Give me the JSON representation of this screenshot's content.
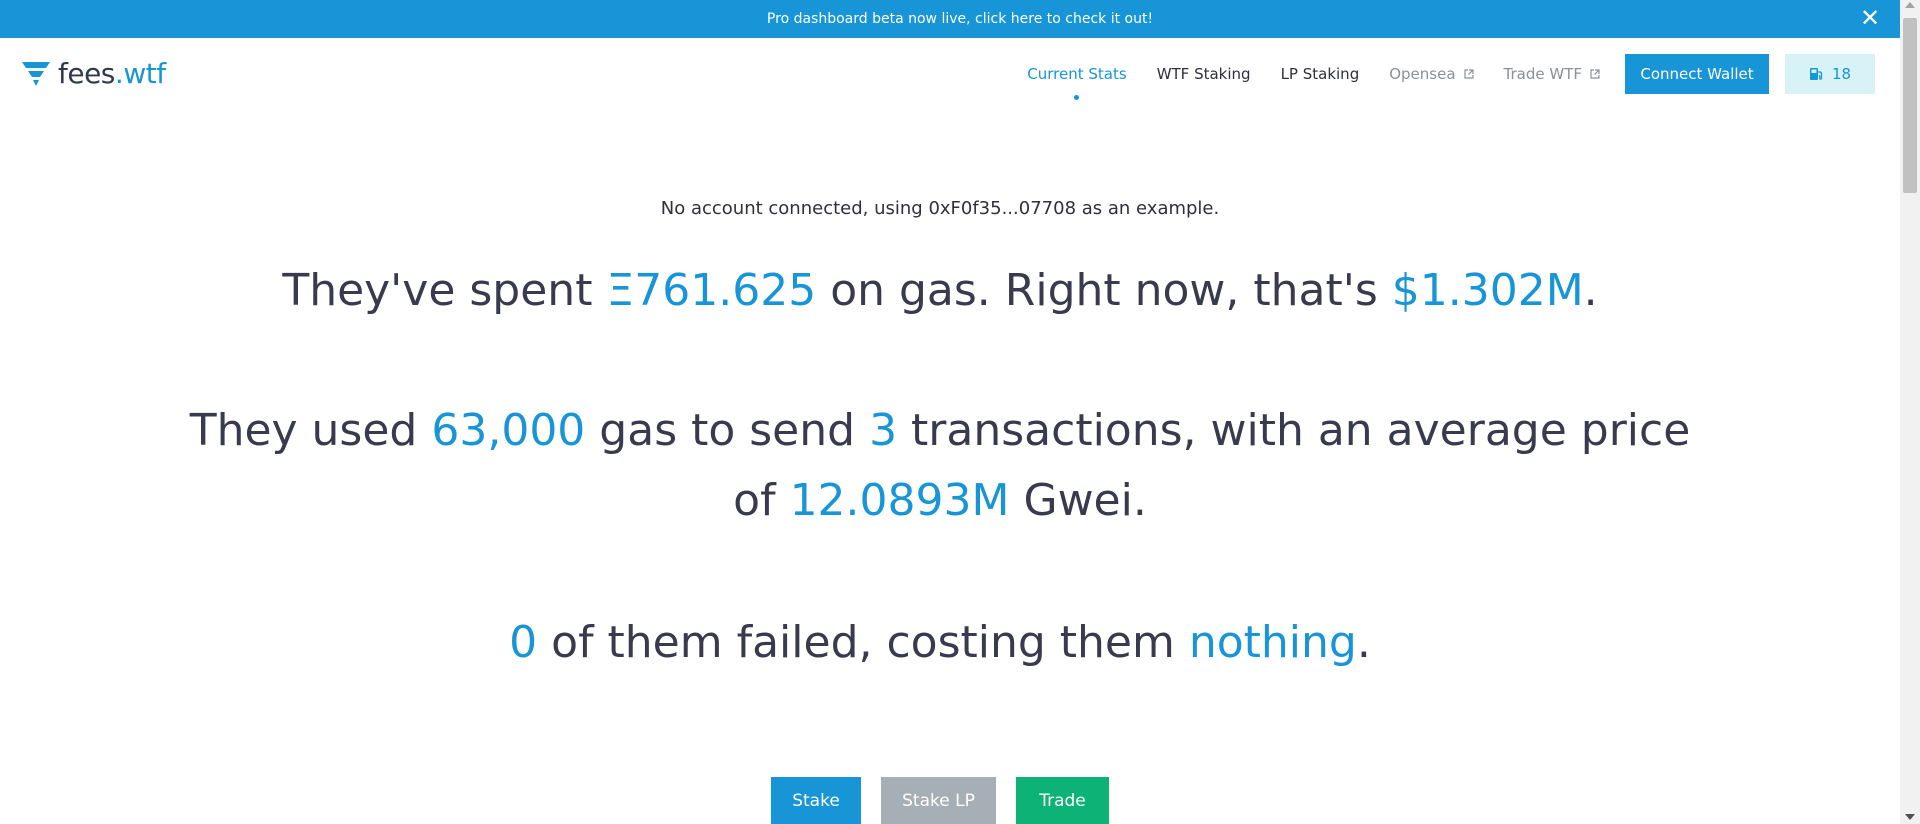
{
  "banner": {
    "text": "Pro dashboard beta now live, click here to check it out!",
    "close_icon": "close-icon"
  },
  "logo": {
    "name_main": "fees",
    "name_dot": ".",
    "name_tld": "wtf",
    "icon": "fees-wtf-logo-icon"
  },
  "nav": {
    "items": [
      {
        "label": "Current Stats",
        "state": "active"
      },
      {
        "label": "WTF Staking",
        "state": "normal"
      },
      {
        "label": "LP Staking",
        "state": "normal"
      },
      {
        "label": "Opensea",
        "state": "external"
      },
      {
        "label": "Trade WTF",
        "state": "external"
      }
    ],
    "connect_label": "Connect Wallet",
    "gas_value": "18",
    "gas_icon": "gas-pump-icon"
  },
  "account_note": {
    "before": "No account connected, using ",
    "address": "0xF0f35...07708",
    "after": " as an example."
  },
  "stats": {
    "line1": {
      "p1": "They've spent ",
      "eth": "Ξ761.625",
      "p2": " on gas. Right now, that's ",
      "usd": "$1.302M",
      "p3": "."
    },
    "line2": {
      "p1": "They used ",
      "gas_used": "63,000",
      "p2": " gas to send ",
      "tx_count": "3",
      "p3": " transactions, with an average price",
      "p4": "of ",
      "avg_price": "12.0893M",
      "p5": " Gwei."
    },
    "line3": {
      "failed": "0",
      "p1": " of them failed, costing them ",
      "cost": "nothing",
      "p2": "."
    }
  },
  "actions": {
    "stake": "Stake",
    "stake_lp": "Stake LP",
    "trade": "Trade"
  },
  "colors": {
    "accent": "#1795d6",
    "text": "#3a3a4e",
    "trade_green": "#0db277",
    "muted_gray": "#a6aeb6",
    "gas_bg": "#d8f3f8"
  }
}
